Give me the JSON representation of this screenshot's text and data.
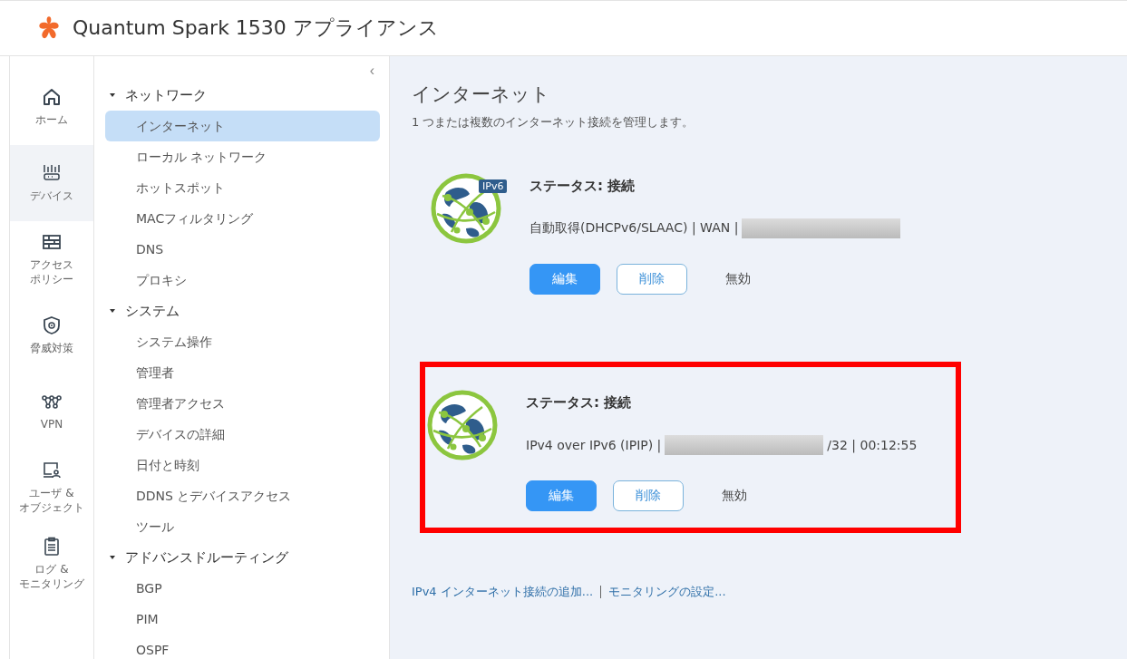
{
  "header": {
    "title": "Quantum Spark 1530 アプライアンス"
  },
  "rail": [
    {
      "lines": [
        "ホーム"
      ],
      "selected": false
    },
    {
      "lines": [
        "デバイス"
      ],
      "selected": true
    },
    {
      "lines": [
        "アクセス",
        "ポリシー"
      ],
      "selected": false
    },
    {
      "lines": [
        "脅威対策"
      ],
      "selected": false
    },
    {
      "lines": [
        "VPN"
      ],
      "selected": false
    },
    {
      "lines": [
        "ユーザ &",
        "オブジェクト"
      ],
      "selected": false
    },
    {
      "lines": [
        "ログ &",
        "モニタリング"
      ],
      "selected": false
    }
  ],
  "nav": {
    "collapse": "‹",
    "groups": [
      {
        "label": "ネットワーク",
        "expanded": true,
        "children": [
          {
            "label": "インターネット",
            "selected": true
          },
          {
            "label": "ローカル ネットワーク",
            "selected": false
          },
          {
            "label": "ホットスポット",
            "selected": false
          },
          {
            "label": "MACフィルタリング",
            "selected": false
          },
          {
            "label": "DNS",
            "selected": false
          },
          {
            "label": "プロキシ",
            "selected": false
          }
        ]
      },
      {
        "label": "システム",
        "expanded": true,
        "children": [
          {
            "label": "システム操作",
            "selected": false
          },
          {
            "label": "管理者",
            "selected": false
          },
          {
            "label": "管理者アクセス",
            "selected": false
          },
          {
            "label": "デバイスの詳細",
            "selected": false
          },
          {
            "label": "日付と時刻",
            "selected": false
          },
          {
            "label": "DDNS とデバイスアクセス",
            "selected": false
          },
          {
            "label": "ツール",
            "selected": false
          }
        ]
      },
      {
        "label": "アドバンスドルーティング",
        "expanded": true,
        "children": [
          {
            "label": "BGP",
            "selected": false
          },
          {
            "label": "PIM",
            "selected": false
          },
          {
            "label": "OSPF",
            "selected": false
          }
        ]
      }
    ]
  },
  "page": {
    "title": "インターネット",
    "subtitle": "1 つまたは複数のインターネット接続を管理します。"
  },
  "connections": [
    {
      "badge": "IPv6",
      "status": "ステータス: 接続",
      "detail_before": "自動取得(DHCPv6/SLAAC) | WAN |",
      "highlighted": false,
      "buttons": [
        "編集",
        "削除",
        "無効"
      ]
    },
    {
      "status": "ステータス: 接続",
      "detail_before": "IPv4 over IPv6 (IPIP) |",
      "detail_after": "/32 | 00:12:55",
      "highlighted": true,
      "buttons": [
        "編集",
        "削除",
        "無効"
      ]
    }
  ],
  "links": [
    "IPv4 インターネット接続の追加...",
    "モニタリングの設定..."
  ]
}
